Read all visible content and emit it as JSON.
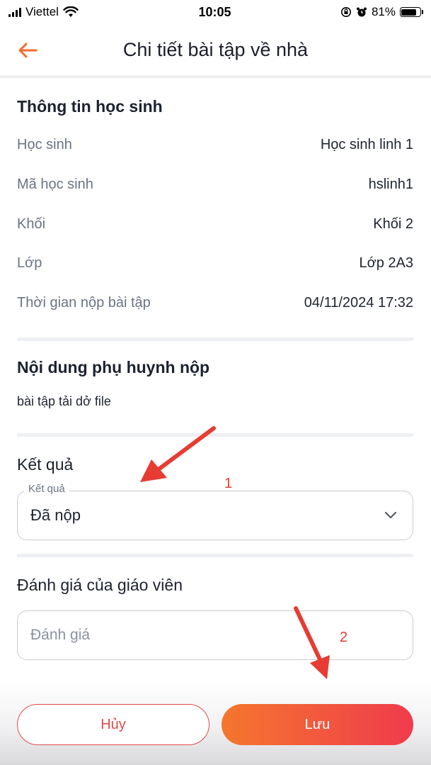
{
  "status_bar": {
    "carrier": "Viettel",
    "time": "10:05",
    "battery": "81%"
  },
  "header": {
    "title": "Chi tiết bài tập về nhà"
  },
  "student_info": {
    "title": "Thông tin học sinh",
    "rows": [
      {
        "label": "Học sinh",
        "value": "Học sinh linh 1"
      },
      {
        "label": "Mã học sinh",
        "value": "hslinh1"
      },
      {
        "label": "Khối",
        "value": "Khối 2"
      },
      {
        "label": "Lớp",
        "value": "Lớp 2A3"
      },
      {
        "label": "Thời gian nộp bài tập",
        "value": "04/11/2024 17:32"
      }
    ]
  },
  "parent_content": {
    "title": "Nội dung phụ huynh nộp",
    "text": "bài tập tải dở file"
  },
  "result": {
    "title": "Kết quả",
    "field_label": "Kết quả",
    "selected": "Đã nộp"
  },
  "evaluation": {
    "title": "Đánh giá của giáo viên",
    "placeholder": "Đánh giá"
  },
  "actions": {
    "cancel_label": "Hủy",
    "save_label": "Lưu"
  },
  "annotations": {
    "marker_1": "1",
    "marker_2": "2",
    "color": "#e63c32"
  },
  "colors": {
    "accent": "#f5762e",
    "danger": "#e24a4a"
  }
}
